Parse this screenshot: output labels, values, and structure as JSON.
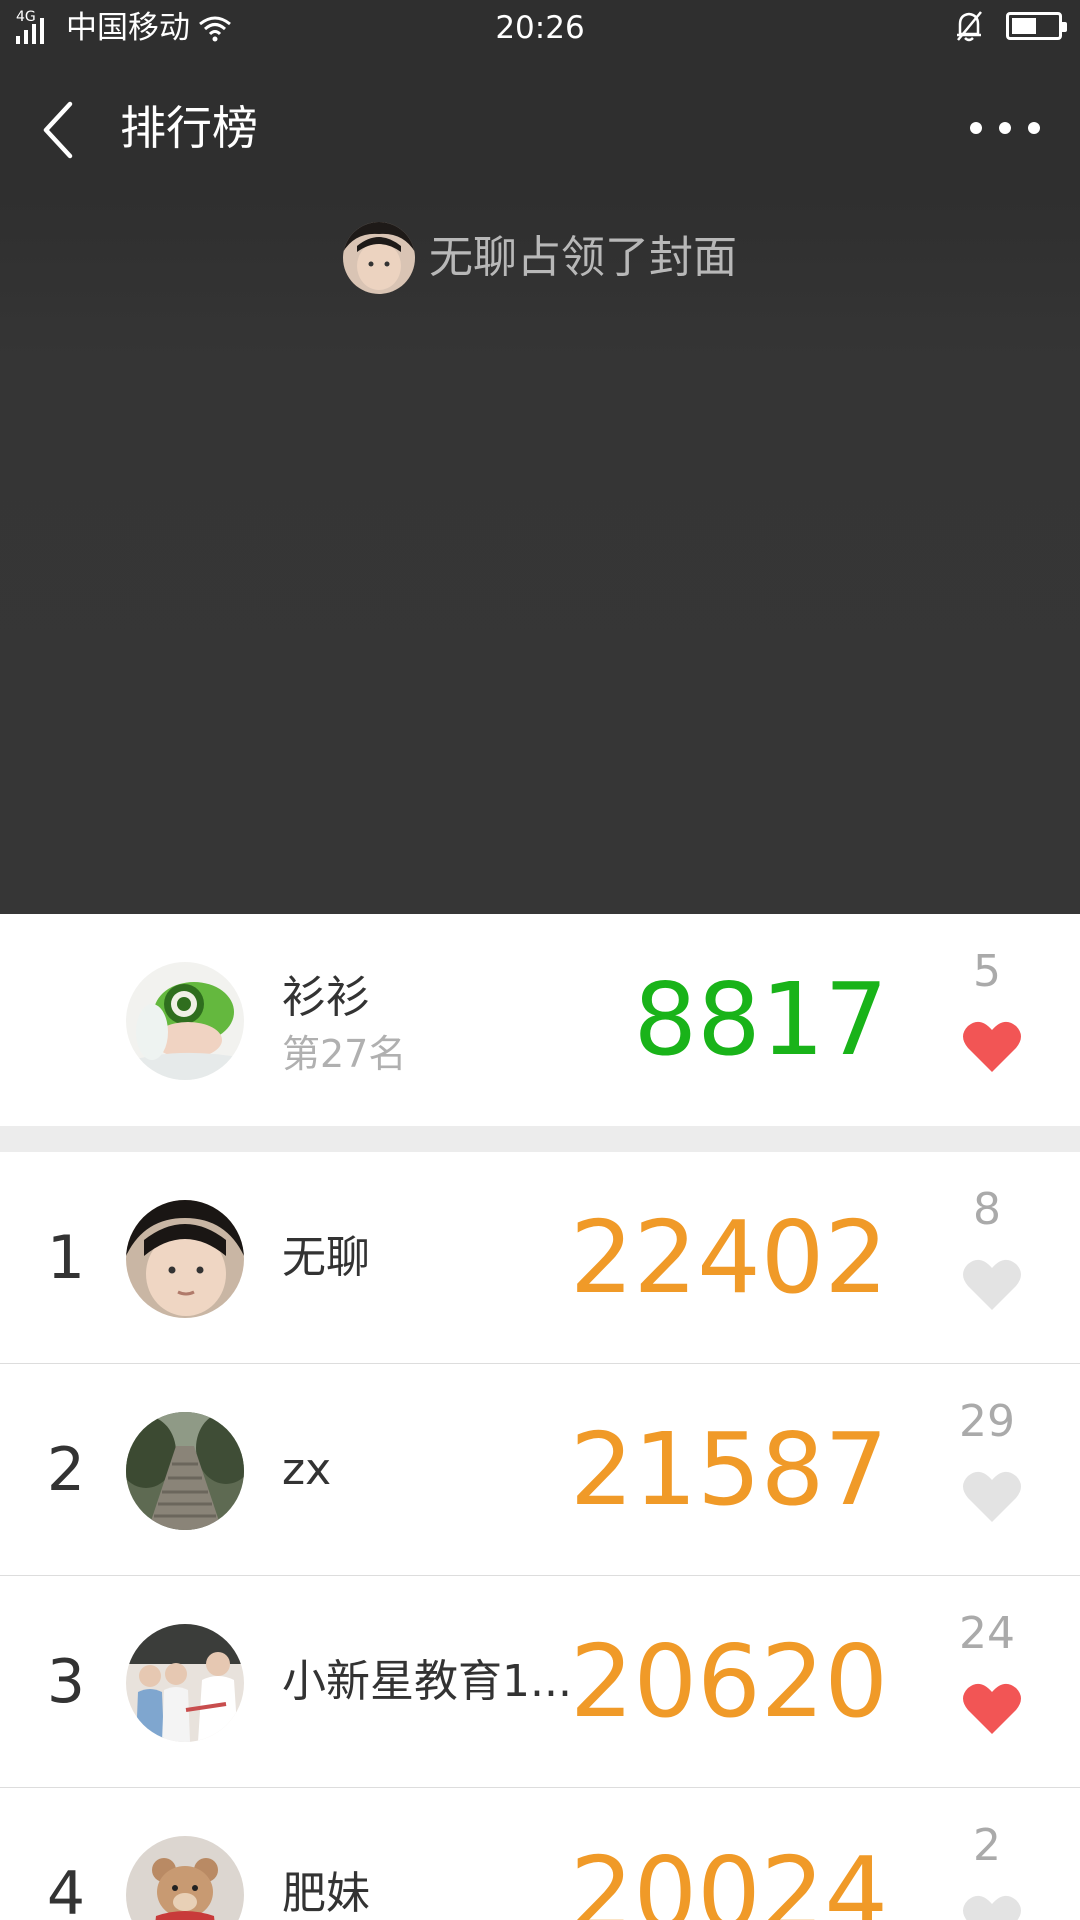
{
  "status_bar": {
    "network": "4G",
    "carrier": "中国移动",
    "time": "20:26",
    "battery_level": 0.55
  },
  "nav": {
    "title": "排行榜"
  },
  "cover": {
    "owner_text": "无聊占领了封面"
  },
  "my_entry": {
    "name": "衫衫",
    "rank_label": "第27名",
    "steps": "8817",
    "likes": "5",
    "liked": true,
    "step_color": "#19b319"
  },
  "leaderboard": [
    {
      "rank": "1",
      "name": "无聊",
      "steps": "22402",
      "likes": "8",
      "liked": false
    },
    {
      "rank": "2",
      "name": "zx",
      "steps": "21587",
      "likes": "29",
      "liked": false
    },
    {
      "rank": "3",
      "name": "小新星教育1...",
      "steps": "20620",
      "likes": "24",
      "liked": true
    },
    {
      "rank": "4",
      "name": "肥妹",
      "steps": "20024",
      "likes": "2",
      "liked": false
    }
  ],
  "colors": {
    "header_bg": "#2f2f2f",
    "leader_steps": "#f09a28",
    "my_steps": "#19b319",
    "heart_active": "#f25555",
    "heart_inactive": "#e3e3e3"
  },
  "icons": {
    "back": "chevron-left-icon",
    "more": "more-dots-icon",
    "like": "heart-icon",
    "silent": "bell-off-icon",
    "wifi": "wifi-icon",
    "battery": "battery-icon"
  }
}
